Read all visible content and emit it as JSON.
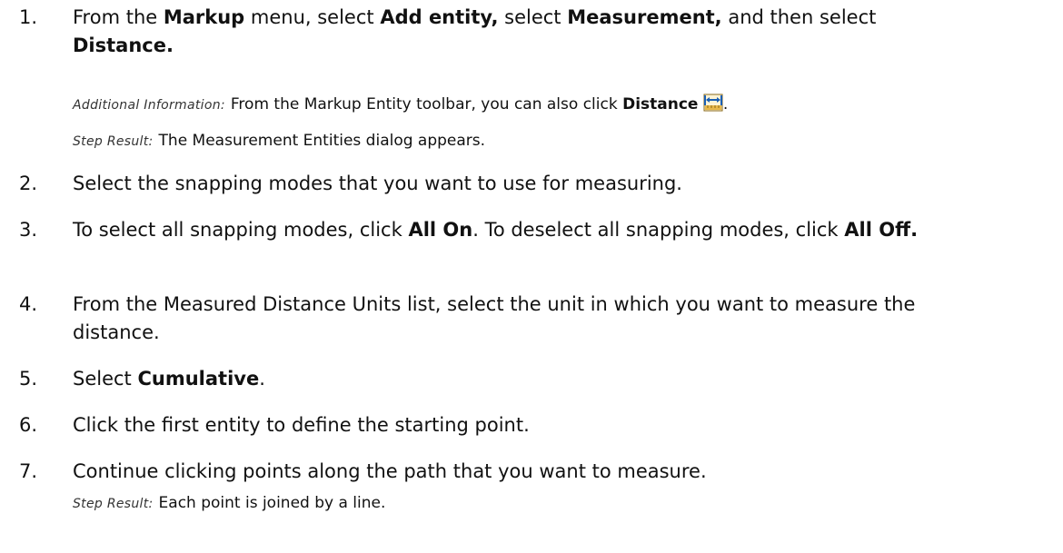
{
  "steps": [
    {
      "num": "1.",
      "parts": [
        "From the ",
        "Markup",
        " menu, select ",
        "Add entity,",
        " select ",
        "Measurement,",
        " and then select ",
        "Distance."
      ]
    },
    {
      "num": "2.",
      "text": "Select the snapping modes that you want to use for measuring."
    },
    {
      "num": "3.",
      "parts": [
        "To select all snapping modes, click ",
        "All On",
        ". To deselect all snapping modes, click ",
        "All Off."
      ]
    },
    {
      "num": "4.",
      "text": "From the Measured Distance Units list, select the unit in which you want to measure the distance."
    },
    {
      "num": "5.",
      "parts": [
        "Select ",
        "Cumulative",
        "."
      ]
    },
    {
      "num": "6.",
      "text": "Click the first entity to define the starting point."
    },
    {
      "num": "7.",
      "text": "Continue clicking points along the path that you want to measure."
    }
  ],
  "step1_additional": {
    "label": "Additional Information:",
    "parts": [
      "From the Markup Entity toolbar, you can also click ",
      "Distance",
      "."
    ],
    "icon": "distance-ruler-icon"
  },
  "step1_result": {
    "label": "Step Result:",
    "text": "The Measurement Entities dialog appears."
  },
  "step7_result": {
    "label": "Step Result:",
    "text": "Each point is joined by a line."
  },
  "colors": {
    "icon_arrow": "#1a5fb4",
    "icon_ruler": "#e8b84a",
    "icon_border": "#8a6a1a"
  }
}
